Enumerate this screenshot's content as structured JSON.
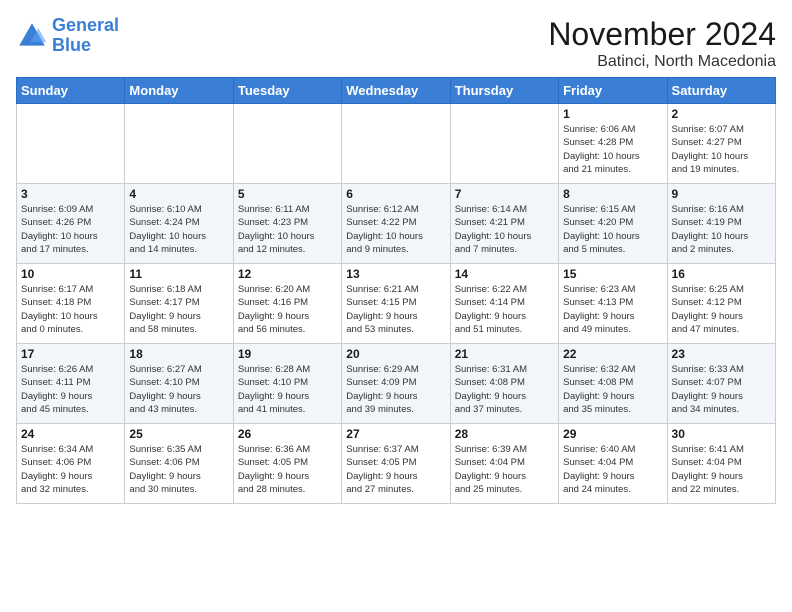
{
  "logo": {
    "line1": "General",
    "line2": "Blue"
  },
  "title": "November 2024",
  "location": "Batinci, North Macedonia",
  "days_of_week": [
    "Sunday",
    "Monday",
    "Tuesday",
    "Wednesday",
    "Thursday",
    "Friday",
    "Saturday"
  ],
  "weeks": [
    [
      {
        "day": "",
        "info": ""
      },
      {
        "day": "",
        "info": ""
      },
      {
        "day": "",
        "info": ""
      },
      {
        "day": "",
        "info": ""
      },
      {
        "day": "",
        "info": ""
      },
      {
        "day": "1",
        "info": "Sunrise: 6:06 AM\nSunset: 4:28 PM\nDaylight: 10 hours\nand 21 minutes."
      },
      {
        "day": "2",
        "info": "Sunrise: 6:07 AM\nSunset: 4:27 PM\nDaylight: 10 hours\nand 19 minutes."
      }
    ],
    [
      {
        "day": "3",
        "info": "Sunrise: 6:09 AM\nSunset: 4:26 PM\nDaylight: 10 hours\nand 17 minutes."
      },
      {
        "day": "4",
        "info": "Sunrise: 6:10 AM\nSunset: 4:24 PM\nDaylight: 10 hours\nand 14 minutes."
      },
      {
        "day": "5",
        "info": "Sunrise: 6:11 AM\nSunset: 4:23 PM\nDaylight: 10 hours\nand 12 minutes."
      },
      {
        "day": "6",
        "info": "Sunrise: 6:12 AM\nSunset: 4:22 PM\nDaylight: 10 hours\nand 9 minutes."
      },
      {
        "day": "7",
        "info": "Sunrise: 6:14 AM\nSunset: 4:21 PM\nDaylight: 10 hours\nand 7 minutes."
      },
      {
        "day": "8",
        "info": "Sunrise: 6:15 AM\nSunset: 4:20 PM\nDaylight: 10 hours\nand 5 minutes."
      },
      {
        "day": "9",
        "info": "Sunrise: 6:16 AM\nSunset: 4:19 PM\nDaylight: 10 hours\nand 2 minutes."
      }
    ],
    [
      {
        "day": "10",
        "info": "Sunrise: 6:17 AM\nSunset: 4:18 PM\nDaylight: 10 hours\nand 0 minutes."
      },
      {
        "day": "11",
        "info": "Sunrise: 6:18 AM\nSunset: 4:17 PM\nDaylight: 9 hours\nand 58 minutes."
      },
      {
        "day": "12",
        "info": "Sunrise: 6:20 AM\nSunset: 4:16 PM\nDaylight: 9 hours\nand 56 minutes."
      },
      {
        "day": "13",
        "info": "Sunrise: 6:21 AM\nSunset: 4:15 PM\nDaylight: 9 hours\nand 53 minutes."
      },
      {
        "day": "14",
        "info": "Sunrise: 6:22 AM\nSunset: 4:14 PM\nDaylight: 9 hours\nand 51 minutes."
      },
      {
        "day": "15",
        "info": "Sunrise: 6:23 AM\nSunset: 4:13 PM\nDaylight: 9 hours\nand 49 minutes."
      },
      {
        "day": "16",
        "info": "Sunrise: 6:25 AM\nSunset: 4:12 PM\nDaylight: 9 hours\nand 47 minutes."
      }
    ],
    [
      {
        "day": "17",
        "info": "Sunrise: 6:26 AM\nSunset: 4:11 PM\nDaylight: 9 hours\nand 45 minutes."
      },
      {
        "day": "18",
        "info": "Sunrise: 6:27 AM\nSunset: 4:10 PM\nDaylight: 9 hours\nand 43 minutes."
      },
      {
        "day": "19",
        "info": "Sunrise: 6:28 AM\nSunset: 4:10 PM\nDaylight: 9 hours\nand 41 minutes."
      },
      {
        "day": "20",
        "info": "Sunrise: 6:29 AM\nSunset: 4:09 PM\nDaylight: 9 hours\nand 39 minutes."
      },
      {
        "day": "21",
        "info": "Sunrise: 6:31 AM\nSunset: 4:08 PM\nDaylight: 9 hours\nand 37 minutes."
      },
      {
        "day": "22",
        "info": "Sunrise: 6:32 AM\nSunset: 4:08 PM\nDaylight: 9 hours\nand 35 minutes."
      },
      {
        "day": "23",
        "info": "Sunrise: 6:33 AM\nSunset: 4:07 PM\nDaylight: 9 hours\nand 34 minutes."
      }
    ],
    [
      {
        "day": "24",
        "info": "Sunrise: 6:34 AM\nSunset: 4:06 PM\nDaylight: 9 hours\nand 32 minutes."
      },
      {
        "day": "25",
        "info": "Sunrise: 6:35 AM\nSunset: 4:06 PM\nDaylight: 9 hours\nand 30 minutes."
      },
      {
        "day": "26",
        "info": "Sunrise: 6:36 AM\nSunset: 4:05 PM\nDaylight: 9 hours\nand 28 minutes."
      },
      {
        "day": "27",
        "info": "Sunrise: 6:37 AM\nSunset: 4:05 PM\nDaylight: 9 hours\nand 27 minutes."
      },
      {
        "day": "28",
        "info": "Sunrise: 6:39 AM\nSunset: 4:04 PM\nDaylight: 9 hours\nand 25 minutes."
      },
      {
        "day": "29",
        "info": "Sunrise: 6:40 AM\nSunset: 4:04 PM\nDaylight: 9 hours\nand 24 minutes."
      },
      {
        "day": "30",
        "info": "Sunrise: 6:41 AM\nSunset: 4:04 PM\nDaylight: 9 hours\nand 22 minutes."
      }
    ]
  ]
}
